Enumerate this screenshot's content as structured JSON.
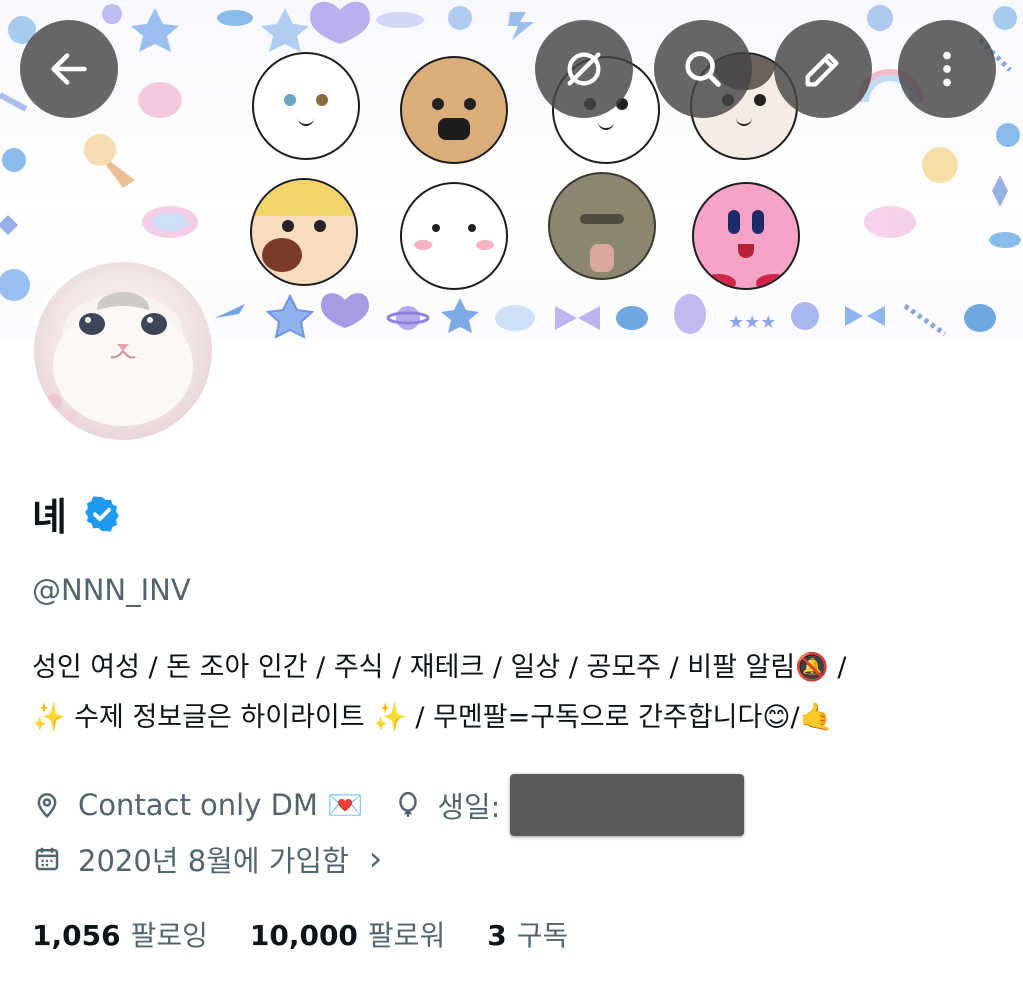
{
  "profile": {
    "name": "녜",
    "handle": "@NNN_INV",
    "bio_line1": "성인 여성 / 돈 조아 인간 / 주식 / 재테크 / 일상 / 공모주 / 비팔 알림🔕 /",
    "bio_line2": "✨ 수제 정보글은 하이라이트 ✨  /  무멘팔=구독으로 간주합니다😊/🤙",
    "location": "Contact only DM 💌",
    "birthday_label": "생일:",
    "joined": "2020년 8월에 가입함",
    "joined_chevron": "›"
  },
  "stats": {
    "following_count": "1,056",
    "following_label": "팔로잉",
    "followers_count": "10,000",
    "followers_label": "팔로워",
    "subs_count": "3",
    "subs_label": "구독"
  },
  "icons": {
    "back": "back-arrow-icon",
    "grok": "slash-circle-icon",
    "search": "search-icon",
    "edit": "edit-pencil-icon",
    "more": "more-vertical-icon",
    "verified": "verified-badge-icon",
    "location": "location-pin-icon",
    "birthday": "balloon-icon",
    "calendar": "calendar-icon"
  },
  "colors": {
    "verified_blue": "#1d9bf0",
    "secondary_text": "#536471",
    "redaction": "#5a5a5a"
  }
}
